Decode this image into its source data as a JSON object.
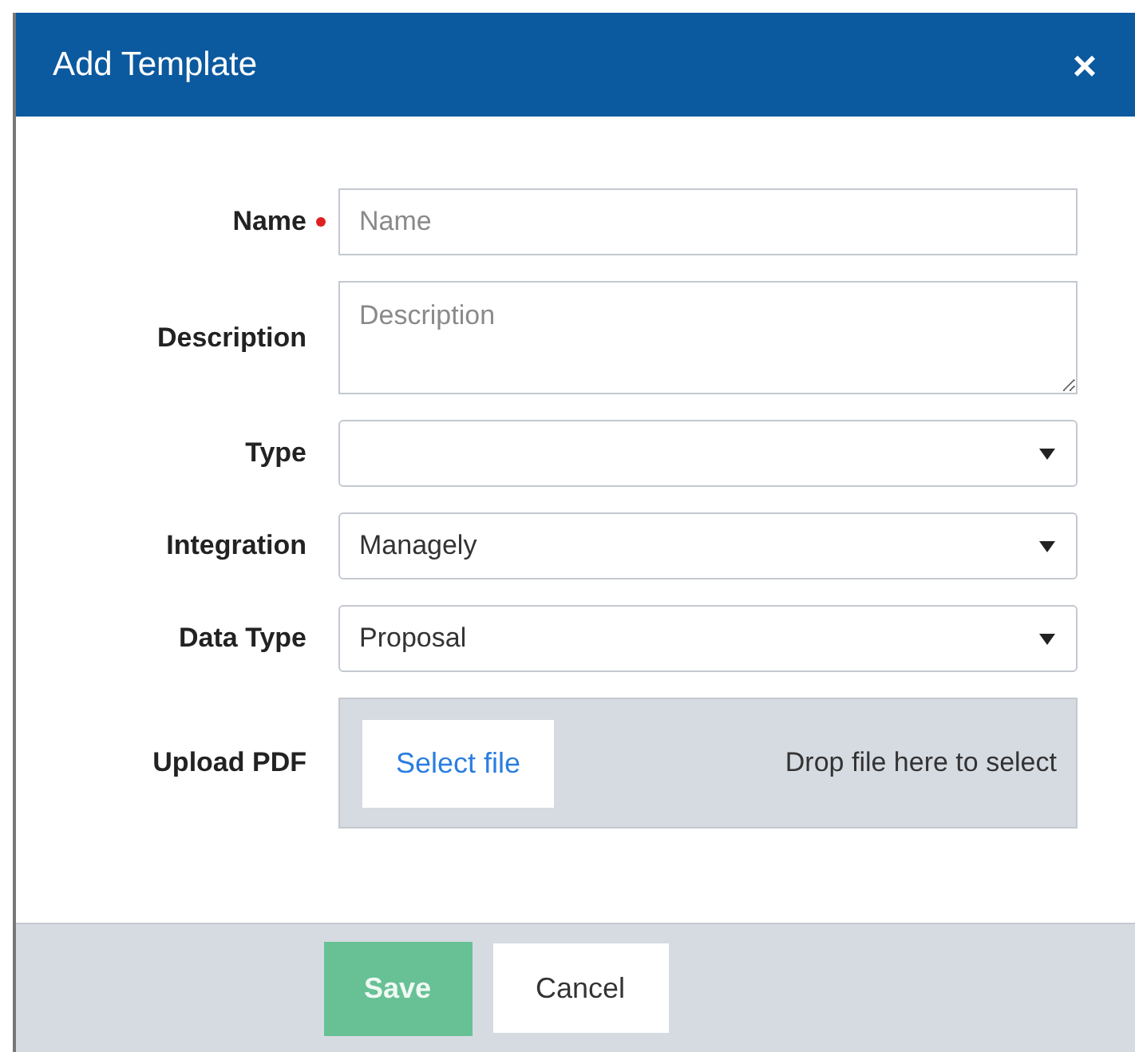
{
  "dialog": {
    "title": "Add Template",
    "close": "×"
  },
  "fields": [
    {
      "kind": "text",
      "label": "Name",
      "required": true,
      "placeholder": "Name"
    },
    {
      "kind": "textarea",
      "label": "Description",
      "required": false,
      "placeholder": "Description"
    },
    {
      "kind": "select",
      "label": "Type",
      "required": false
    },
    {
      "kind": "select",
      "label": "Integration",
      "required": false,
      "value": "Managely"
    },
    {
      "kind": "select",
      "label": "Data Type",
      "required": false,
      "value": "Proposal"
    },
    {
      "kind": "upload",
      "label": "Upload PDF",
      "required": false,
      "button": "Select file",
      "hint": "Drop file here to select"
    }
  ],
  "footer": {
    "buttons": [
      {
        "kind": "primary",
        "label": "Save",
        "disabled": true
      },
      {
        "kind": "secondary",
        "label": "Cancel",
        "disabled": false
      }
    ]
  }
}
